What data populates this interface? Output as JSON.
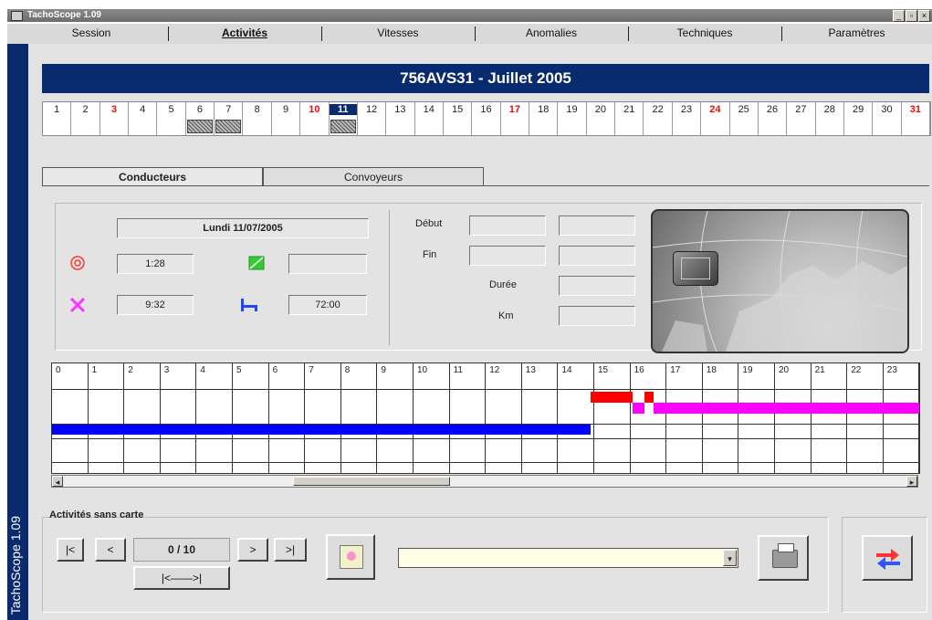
{
  "window": {
    "title": "TachoScope 1.09"
  },
  "menu": {
    "tabs": [
      "Session",
      "Activités",
      "Vitesses",
      "Anomalies",
      "Techniques",
      "Paramètres"
    ],
    "active": "Activités"
  },
  "side": {
    "label": "TachoScope 1.09"
  },
  "header": {
    "title": "756AVS31  -  Juillet 2005"
  },
  "calendar": {
    "days": [
      {
        "n": "1",
        "red": false,
        "hatch": false
      },
      {
        "n": "2",
        "red": false,
        "hatch": false
      },
      {
        "n": "3",
        "red": true,
        "hatch": false
      },
      {
        "n": "4",
        "red": false,
        "hatch": false
      },
      {
        "n": "5",
        "red": false,
        "hatch": false
      },
      {
        "n": "6",
        "red": false,
        "hatch": true
      },
      {
        "n": "7",
        "red": false,
        "hatch": true
      },
      {
        "n": "8",
        "red": false,
        "hatch": false
      },
      {
        "n": "9",
        "red": false,
        "hatch": false
      },
      {
        "n": "10",
        "red": true,
        "hatch": false
      },
      {
        "n": "11",
        "red": false,
        "hatch": true,
        "selected": true
      },
      {
        "n": "12",
        "red": false,
        "hatch": false
      },
      {
        "n": "13",
        "red": false,
        "hatch": false
      },
      {
        "n": "14",
        "red": false,
        "hatch": false
      },
      {
        "n": "15",
        "red": false,
        "hatch": false
      },
      {
        "n": "16",
        "red": false,
        "hatch": false
      },
      {
        "n": "17",
        "red": true,
        "hatch": false
      },
      {
        "n": "18",
        "red": false,
        "hatch": false
      },
      {
        "n": "19",
        "red": false,
        "hatch": false
      },
      {
        "n": "20",
        "red": false,
        "hatch": false
      },
      {
        "n": "21",
        "red": false,
        "hatch": false
      },
      {
        "n": "22",
        "red": false,
        "hatch": false
      },
      {
        "n": "23",
        "red": false,
        "hatch": false
      },
      {
        "n": "24",
        "red": true,
        "hatch": false
      },
      {
        "n": "25",
        "red": false,
        "hatch": false
      },
      {
        "n": "26",
        "red": false,
        "hatch": false
      },
      {
        "n": "27",
        "red": false,
        "hatch": false
      },
      {
        "n": "28",
        "red": false,
        "hatch": false
      },
      {
        "n": "29",
        "red": false,
        "hatch": false
      },
      {
        "n": "30",
        "red": false,
        "hatch": false
      },
      {
        "n": "31",
        "red": true,
        "hatch": false
      }
    ]
  },
  "tabs": {
    "conducteurs": "Conducteurs",
    "convoyeurs": "Convoyeurs"
  },
  "details": {
    "date": "Lundi 11/07/2005",
    "driving_time": "1:28",
    "work_time": "9:32",
    "availability": "",
    "rest_time": "72:00",
    "debut_label": "Début",
    "fin_label": "Fin",
    "duree_label": "Durée",
    "km_label": "Km"
  },
  "timeline": {
    "hours": [
      "0",
      "1",
      "2",
      "3",
      "4",
      "5",
      "6",
      "7",
      "8",
      "9",
      "10",
      "11",
      "12",
      "13",
      "14",
      "15",
      "16",
      "17",
      "18",
      "19",
      "20",
      "21",
      "22",
      "23"
    ],
    "segments": [
      {
        "activity": "rest",
        "color": "#0000ff",
        "start": 0.0,
        "end": 14.9
      },
      {
        "activity": "work",
        "color": "#ff0000",
        "start": 14.9,
        "end": 16.05
      },
      {
        "activity": "availability",
        "color": "#ff00ff",
        "start": 16.05,
        "end": 16.4
      },
      {
        "activity": "work",
        "color": "#ff0000",
        "start": 16.4,
        "end": 16.65
      },
      {
        "activity": "availability",
        "color": "#ff00ff",
        "start": 16.65,
        "end": 24.0
      }
    ]
  },
  "nav": {
    "section_label": "Activités sans carte",
    "first": "|<",
    "prev": "<",
    "counter": "0 / 10",
    "next": ">",
    "last": ">|",
    "range": "|<——>|",
    "combo_value": ""
  },
  "colors": {
    "header_bg": "#082a6e",
    "weekend_red": "#e01010",
    "rest": "#0000ff",
    "work": "#ff0000",
    "avail": "#ff00ff",
    "driving": "#ff3333",
    "tool": "#ff33ff",
    "bed": "#2244ff",
    "green": "#33cc33"
  }
}
